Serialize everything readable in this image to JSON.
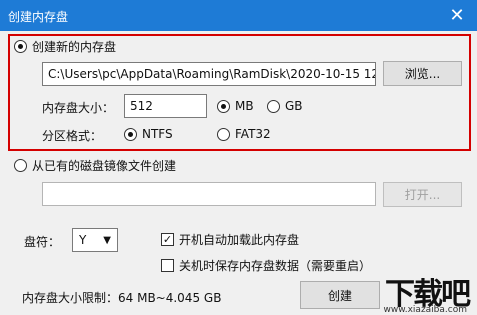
{
  "window": {
    "title": "创建内存盘",
    "close_glyph": "✕"
  },
  "new_disk": {
    "radio_label": "创建新的内存盘",
    "path_value": "C:\\Users\\pc\\AppData\\Roaming\\RamDisk\\2020-10-15 12",
    "browse_label": "浏览...",
    "size_label": "内存盘大小：",
    "size_value": "512",
    "unit_mb": "MB",
    "unit_gb": "GB",
    "format_label": "分区格式：",
    "fs_ntfs": "NTFS",
    "fs_fat32": "FAT32"
  },
  "existing_image": {
    "radio_label": "从已有的磁盘镜像文件创建",
    "path_value": "",
    "open_label": "打开..."
  },
  "drive": {
    "label": "盘符：",
    "value": "Y"
  },
  "options": {
    "autoload_label": "开机自动加载此内存盘",
    "save_on_shutdown_label": "关机时保存内存盘数据（需要重启）"
  },
  "footer": {
    "limit_text": "内存盘大小限制：64 MB~4.045 GB",
    "create_label": "创建"
  },
  "watermark": {
    "brand": "下载吧",
    "domain": "www.xiazaiba.com"
  },
  "colors": {
    "titlebar": "#1e7bd6",
    "highlight_border": "#d40000"
  }
}
